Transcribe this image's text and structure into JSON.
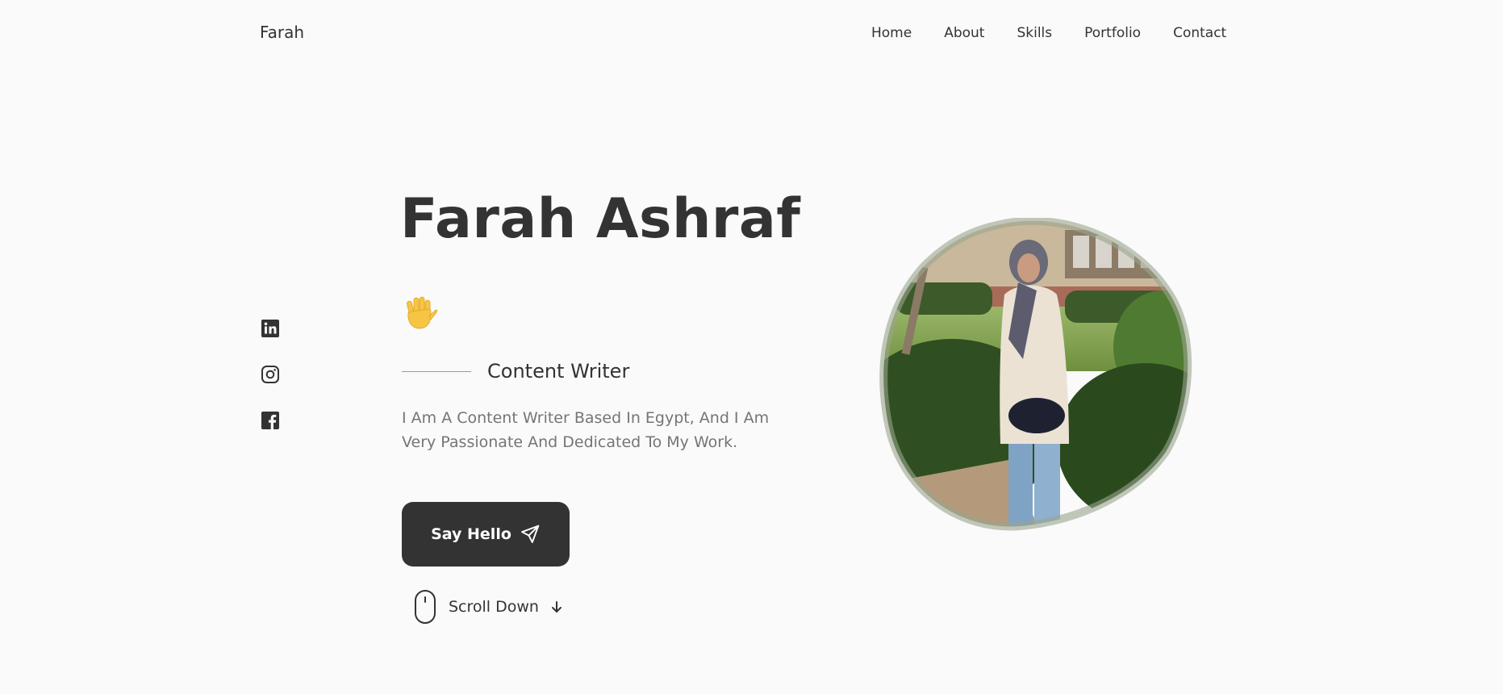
{
  "header": {
    "logo": "Farah",
    "nav": [
      "Home",
      "About",
      "Skills",
      "Portfolio",
      "Contact"
    ]
  },
  "social": [
    {
      "name": "linkedin-icon"
    },
    {
      "name": "instagram-icon"
    },
    {
      "name": "facebook-icon"
    }
  ],
  "hero": {
    "title": "Farah Ashraf",
    "wave_icon": "waving-hand-icon",
    "subtitle": "Content Writer",
    "description": "I Am A Content Writer Based In Egypt, And I Am Very Passionate And Dedicated To My Work.",
    "cta_label": "Say Hello",
    "cta_icon": "send-icon",
    "scroll_label": "Scroll Down"
  },
  "colors": {
    "background": "#fafafa",
    "text": "#333333",
    "muted": "#757575",
    "button": "#333333",
    "button_text": "#ffffff"
  }
}
